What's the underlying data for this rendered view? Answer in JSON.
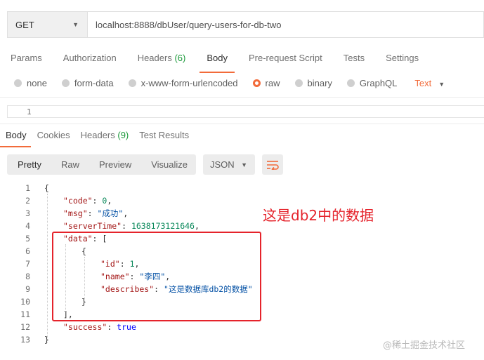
{
  "request": {
    "method": "GET",
    "url": "localhost:8888/dbUser/query-users-for-db-two"
  },
  "request_tabs": [
    {
      "label": "Params"
    },
    {
      "label": "Authorization"
    },
    {
      "label": "Headers",
      "count": "(6)"
    },
    {
      "label": "Body"
    },
    {
      "label": "Pre-request Script"
    },
    {
      "label": "Tests"
    },
    {
      "label": "Settings"
    }
  ],
  "body_types": [
    "none",
    "form-data",
    "x-www-form-urlencoded",
    "raw",
    "binary",
    "GraphQL"
  ],
  "body_format": "Text",
  "editor_line": "1",
  "response_tabs": [
    {
      "label": "Body"
    },
    {
      "label": "Cookies"
    },
    {
      "label": "Headers",
      "count": "(9)"
    },
    {
      "label": "Test Results"
    }
  ],
  "view_modes": [
    "Pretty",
    "Raw",
    "Preview",
    "Visualize"
  ],
  "view_format": "JSON",
  "response_lines": [
    "1",
    "2",
    "3",
    "4",
    "5",
    "6",
    "7",
    "8",
    "9",
    "10",
    "11",
    "12",
    "13"
  ],
  "json": {
    "code_key": "\"code\"",
    "code_val": "0",
    "msg_key": "\"msg\"",
    "msg_val": "\"成功\"",
    "time_key": "\"serverTime\"",
    "time_val": "1638173121646",
    "data_key": "\"data\"",
    "id_key": "\"id\"",
    "id_val": "1",
    "name_key": "\"name\"",
    "name_val": "\"李四\"",
    "desc_key": "\"describes\"",
    "desc_val": "\"这是数据库db2的数据\"",
    "success_key": "\"success\"",
    "success_val": "true"
  },
  "annotation": "这是db2中的数据",
  "watermark": "@稀土掘金技术社区",
  "colors": {
    "accent": "#f26b3a",
    "annotation": "#e5232b",
    "count": "#1c9a3b"
  }
}
